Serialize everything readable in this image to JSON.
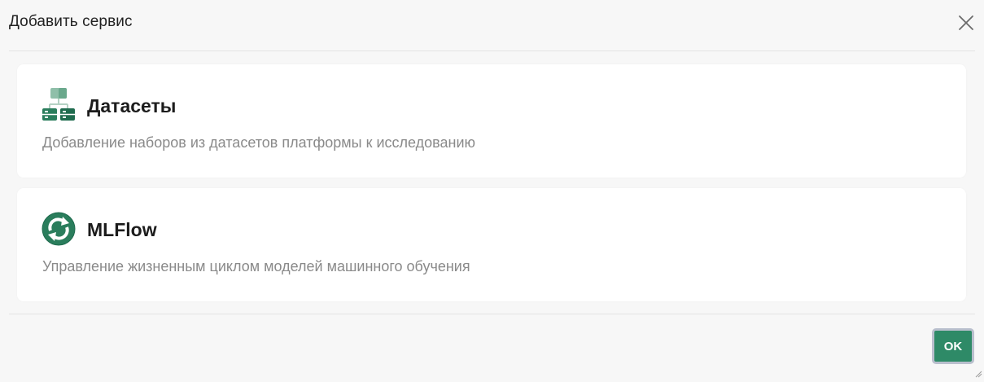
{
  "dialog": {
    "title": "Добавить сервис"
  },
  "services": [
    {
      "title": "Датасеты",
      "description": "Добавление наборов из датасетов платформы к исследованию",
      "icon": "datasets-icon"
    },
    {
      "title": "MLFlow",
      "description": "Управление жизненным циклом моделей машинного обучения",
      "icon": "mlflow-icon"
    }
  ],
  "footer": {
    "ok_label": "OK"
  },
  "colors": {
    "accent": "#2e8a67",
    "icon_dark": "#1f6b4e",
    "icon_light": "#8fbfa9"
  }
}
